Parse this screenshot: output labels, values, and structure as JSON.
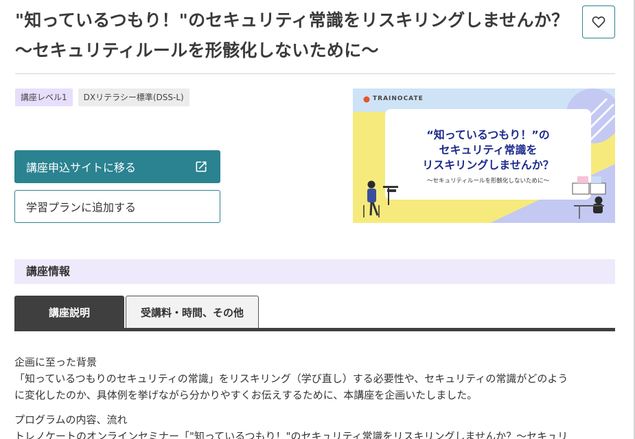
{
  "course": {
    "title": "\"知っているつもり！\"のセキュリティ常識をリスキリングしませんか？　～セキュリティルールを形骸化しないために～",
    "favorite_icon": "heart-icon"
  },
  "tags": {
    "level": "講座レベル1",
    "standard": "DXリテラシー標準(DSS-L)"
  },
  "actions": {
    "apply_label": "講座申込サイトに移る",
    "apply_icon": "external-link-icon",
    "plan_label": "学習プランに追加する"
  },
  "banner": {
    "brand": "TRAINOCATE",
    "headline_line1": "“知っているつもり！”の",
    "headline_line2": "セキュリティ常識を",
    "headline_line3": "リスキリングしませんか？",
    "subline": "～セキュリティルールを形骸化しないために～"
  },
  "section": {
    "title": "講座情報"
  },
  "tabs": [
    {
      "label": "講座説明",
      "active": true
    },
    {
      "label": "受講料・時間、その他",
      "active": false
    }
  ],
  "content": {
    "p1_heading": "企画に至った背景",
    "p1_line1": "「知っているつもりのセキュリティの常識」をリスキリング（学び直し）する必要性や、セキュリティの常識がどのよう",
    "p1_line2": "に変化したのか、具体例を挙げながら分かりやすくお伝えするために、本講座を企画いたしました。",
    "p2_heading": "プログラムの内容、流れ",
    "p2_line1": "トレノケートのオンラインセミナー「\"知っているつもり！\"のセキュリティ常識をリスキリングしませんか？～セキュリ"
  },
  "colors": {
    "accent": "#2b8290",
    "tab_active": "#3f3f3f",
    "tag_level_bg": "#e7defb",
    "section_bg": "#eeeafb",
    "banner_yellow": "#f6ea7d",
    "banner_blue": "#c9ddf4",
    "banner_text": "#1c2a8c"
  }
}
